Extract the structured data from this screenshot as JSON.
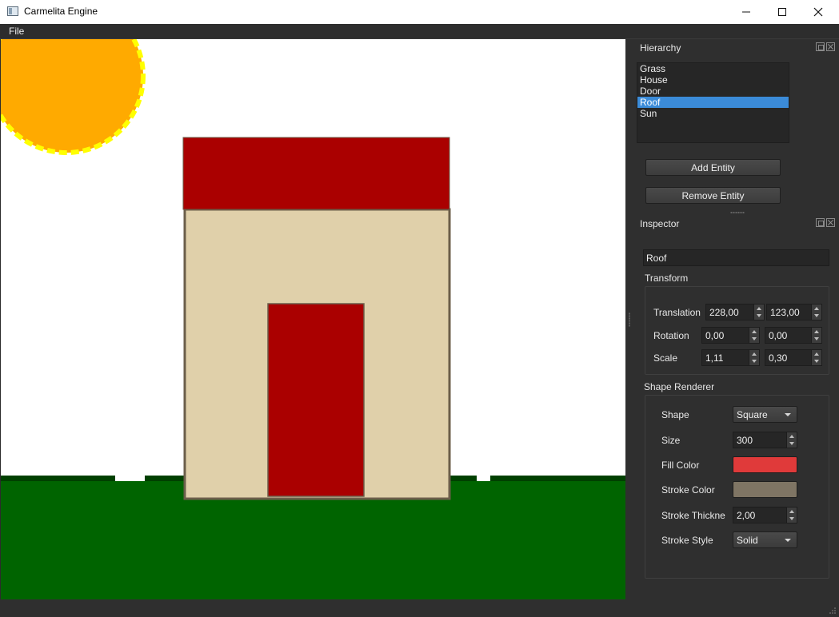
{
  "window": {
    "title": "Carmelita Engine"
  },
  "menu": {
    "file": "File"
  },
  "scene": {
    "sky_color": "#ffffff",
    "sun_color": "#ffaa00",
    "sun_stroke": "#ffff00",
    "roof_color": "#aa0000",
    "house_color": "#e0d0aa",
    "house_stroke": "#6b5e4a",
    "door_color": "#aa0000",
    "grass_color": "#006400",
    "grass_edge_color": "#004000"
  },
  "hierarchy": {
    "title": "Hierarchy",
    "items": [
      "Grass",
      "House",
      "Door",
      "Roof",
      "Sun"
    ],
    "selected": "Roof",
    "add_button": "Add Entity",
    "remove_button": "Remove Entity"
  },
  "inspector": {
    "title": "Inspector",
    "entity_name": "Roof",
    "transform": {
      "title": "Transform",
      "translation_label": "Translation",
      "translation_x": "228,00",
      "translation_y": "123,00",
      "rotation_label": "Rotation",
      "rotation_x": "0,00",
      "rotation_y": "0,00",
      "scale_label": "Scale",
      "scale_x": "1,11",
      "scale_y": "0,30"
    },
    "shape_renderer": {
      "title": "Shape Renderer",
      "shape_label": "Shape",
      "shape_value": "Square",
      "size_label": "Size",
      "size_value": "300",
      "fill_label": "Fill Color",
      "fill_color": "#e03a3a",
      "stroke_color_label": "Stroke Color",
      "stroke_color": "#7f7564",
      "stroke_thickness_label": "Stroke Thickne",
      "stroke_thickness_value": "2,00",
      "stroke_style_label": "Stroke Style",
      "stroke_style_value": "Solid"
    }
  }
}
